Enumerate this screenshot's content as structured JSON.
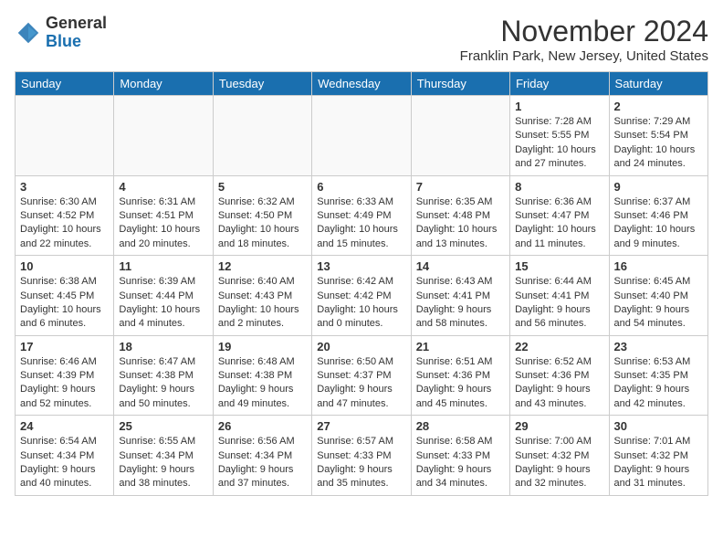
{
  "header": {
    "logo_line1": "General",
    "logo_line2": "Blue",
    "month_year": "November 2024",
    "location": "Franklin Park, New Jersey, United States"
  },
  "days_of_week": [
    "Sunday",
    "Monday",
    "Tuesday",
    "Wednesday",
    "Thursday",
    "Friday",
    "Saturday"
  ],
  "weeks": [
    [
      {
        "day": "",
        "info": ""
      },
      {
        "day": "",
        "info": ""
      },
      {
        "day": "",
        "info": ""
      },
      {
        "day": "",
        "info": ""
      },
      {
        "day": "",
        "info": ""
      },
      {
        "day": "1",
        "info": "Sunrise: 7:28 AM\nSunset: 5:55 PM\nDaylight: 10 hours and 27 minutes."
      },
      {
        "day": "2",
        "info": "Sunrise: 7:29 AM\nSunset: 5:54 PM\nDaylight: 10 hours and 24 minutes."
      }
    ],
    [
      {
        "day": "3",
        "info": "Sunrise: 6:30 AM\nSunset: 4:52 PM\nDaylight: 10 hours and 22 minutes."
      },
      {
        "day": "4",
        "info": "Sunrise: 6:31 AM\nSunset: 4:51 PM\nDaylight: 10 hours and 20 minutes."
      },
      {
        "day": "5",
        "info": "Sunrise: 6:32 AM\nSunset: 4:50 PM\nDaylight: 10 hours and 18 minutes."
      },
      {
        "day": "6",
        "info": "Sunrise: 6:33 AM\nSunset: 4:49 PM\nDaylight: 10 hours and 15 minutes."
      },
      {
        "day": "7",
        "info": "Sunrise: 6:35 AM\nSunset: 4:48 PM\nDaylight: 10 hours and 13 minutes."
      },
      {
        "day": "8",
        "info": "Sunrise: 6:36 AM\nSunset: 4:47 PM\nDaylight: 10 hours and 11 minutes."
      },
      {
        "day": "9",
        "info": "Sunrise: 6:37 AM\nSunset: 4:46 PM\nDaylight: 10 hours and 9 minutes."
      }
    ],
    [
      {
        "day": "10",
        "info": "Sunrise: 6:38 AM\nSunset: 4:45 PM\nDaylight: 10 hours and 6 minutes."
      },
      {
        "day": "11",
        "info": "Sunrise: 6:39 AM\nSunset: 4:44 PM\nDaylight: 10 hours and 4 minutes."
      },
      {
        "day": "12",
        "info": "Sunrise: 6:40 AM\nSunset: 4:43 PM\nDaylight: 10 hours and 2 minutes."
      },
      {
        "day": "13",
        "info": "Sunrise: 6:42 AM\nSunset: 4:42 PM\nDaylight: 10 hours and 0 minutes."
      },
      {
        "day": "14",
        "info": "Sunrise: 6:43 AM\nSunset: 4:41 PM\nDaylight: 9 hours and 58 minutes."
      },
      {
        "day": "15",
        "info": "Sunrise: 6:44 AM\nSunset: 4:41 PM\nDaylight: 9 hours and 56 minutes."
      },
      {
        "day": "16",
        "info": "Sunrise: 6:45 AM\nSunset: 4:40 PM\nDaylight: 9 hours and 54 minutes."
      }
    ],
    [
      {
        "day": "17",
        "info": "Sunrise: 6:46 AM\nSunset: 4:39 PM\nDaylight: 9 hours and 52 minutes."
      },
      {
        "day": "18",
        "info": "Sunrise: 6:47 AM\nSunset: 4:38 PM\nDaylight: 9 hours and 50 minutes."
      },
      {
        "day": "19",
        "info": "Sunrise: 6:48 AM\nSunset: 4:38 PM\nDaylight: 9 hours and 49 minutes."
      },
      {
        "day": "20",
        "info": "Sunrise: 6:50 AM\nSunset: 4:37 PM\nDaylight: 9 hours and 47 minutes."
      },
      {
        "day": "21",
        "info": "Sunrise: 6:51 AM\nSunset: 4:36 PM\nDaylight: 9 hours and 45 minutes."
      },
      {
        "day": "22",
        "info": "Sunrise: 6:52 AM\nSunset: 4:36 PM\nDaylight: 9 hours and 43 minutes."
      },
      {
        "day": "23",
        "info": "Sunrise: 6:53 AM\nSunset: 4:35 PM\nDaylight: 9 hours and 42 minutes."
      }
    ],
    [
      {
        "day": "24",
        "info": "Sunrise: 6:54 AM\nSunset: 4:34 PM\nDaylight: 9 hours and 40 minutes."
      },
      {
        "day": "25",
        "info": "Sunrise: 6:55 AM\nSunset: 4:34 PM\nDaylight: 9 hours and 38 minutes."
      },
      {
        "day": "26",
        "info": "Sunrise: 6:56 AM\nSunset: 4:34 PM\nDaylight: 9 hours and 37 minutes."
      },
      {
        "day": "27",
        "info": "Sunrise: 6:57 AM\nSunset: 4:33 PM\nDaylight: 9 hours and 35 minutes."
      },
      {
        "day": "28",
        "info": "Sunrise: 6:58 AM\nSunset: 4:33 PM\nDaylight: 9 hours and 34 minutes."
      },
      {
        "day": "29",
        "info": "Sunrise: 7:00 AM\nSunset: 4:32 PM\nDaylight: 9 hours and 32 minutes."
      },
      {
        "day": "30",
        "info": "Sunrise: 7:01 AM\nSunset: 4:32 PM\nDaylight: 9 hours and 31 minutes."
      }
    ]
  ]
}
